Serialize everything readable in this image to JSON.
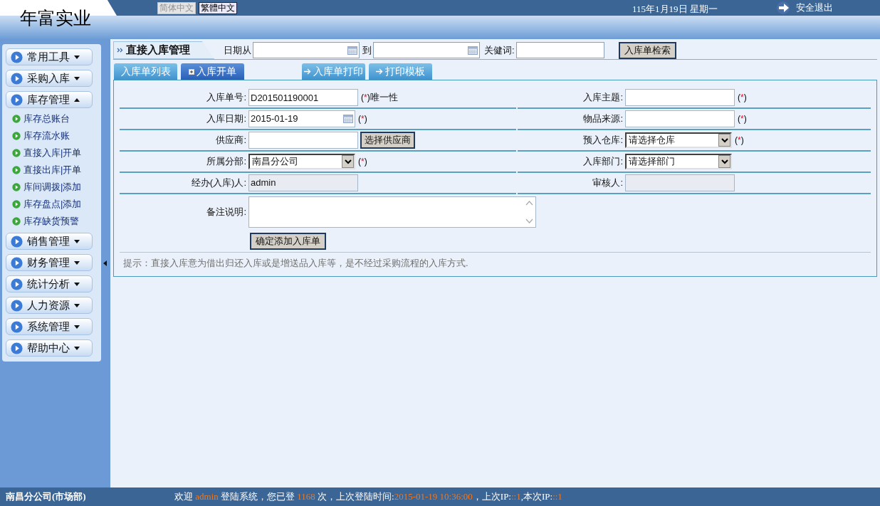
{
  "header": {
    "logo": "年富实业",
    "languages": [
      {
        "label": "简体中文",
        "selected": false
      },
      {
        "label": "繁體中文",
        "selected": true
      }
    ],
    "date": "115年1月19日 星期一",
    "logout": "安全退出"
  },
  "sidebar": {
    "groups": [
      {
        "label": "常用工具",
        "expanded": false
      },
      {
        "label": "采购入库",
        "expanded": false
      },
      {
        "label": "库存管理",
        "expanded": true,
        "children": [
          {
            "label": "库存总账台"
          },
          {
            "label": "库存流水账"
          },
          {
            "label": "直接入库|开单"
          },
          {
            "label": "直接出库|开单"
          },
          {
            "label": "库间调拨|添加"
          },
          {
            "label": "库存盘点|添加"
          },
          {
            "label": "库存缺货预警"
          }
        ]
      },
      {
        "label": "销售管理",
        "expanded": false
      },
      {
        "label": "财务管理",
        "expanded": false
      },
      {
        "label": "统计分析",
        "expanded": false
      },
      {
        "label": "人力资源",
        "expanded": false
      },
      {
        "label": "系统管理",
        "expanded": false
      },
      {
        "label": "帮助中心",
        "expanded": false
      }
    ]
  },
  "toolbar": {
    "title": "直接入库管理",
    "date_from_label": "日期从",
    "date_to_label": "到",
    "keyword_label": "关健词:",
    "search_button": "入库单检索"
  },
  "tabs": [
    {
      "label": "入库单列表",
      "selected": false,
      "kind": "plain"
    },
    {
      "label": "入库开单",
      "selected": true,
      "kind": "plus"
    },
    {
      "label": "入库单打印",
      "selected": false,
      "kind": "arrow"
    },
    {
      "label": "打印模板",
      "selected": false,
      "kind": "arrow"
    }
  ],
  "form": {
    "rows": [
      [
        {
          "label": "入库单号:",
          "kind": "text",
          "value": "D201501190001",
          "required": "(*)",
          "note": "唯一性"
        },
        {
          "label": "入库主题:",
          "kind": "text",
          "required": "(*)"
        }
      ],
      [
        {
          "label": "入库日期:",
          "kind": "date",
          "value": "2015-01-19",
          "required": "(*)"
        },
        {
          "label": "物品来源:",
          "kind": "text",
          "required": "(*)"
        }
      ],
      [
        {
          "label": "供应商:",
          "kind": "text",
          "button": "选择供应商"
        },
        {
          "label": "预入仓库:",
          "kind": "select",
          "value": "请选择仓库",
          "required": "(*)"
        }
      ],
      [
        {
          "label": "所属分部:",
          "kind": "select",
          "value": "南昌分公司",
          "required": "(*)"
        },
        {
          "label": "入库部门:",
          "kind": "select",
          "value": "请选择部门"
        }
      ],
      [
        {
          "label": "经办(入库)人:",
          "kind": "readonly",
          "value": "admin"
        },
        {
          "label": "审核人:",
          "kind": "readonly"
        }
      ]
    ],
    "remark_label": "备注说明:",
    "submit": "确定添加入库单",
    "hint": "提示：直接入库意为借出归还入库或是增送品入库等，是不经过采购流程的入库方式."
  },
  "footer": {
    "branch": "南昌分公司(市场部)",
    "welcome": [
      {
        "text": "欢迎 ",
        "highlight": false
      },
      {
        "text": "admin",
        "highlight": true
      },
      {
        "text": " 登陆系统，您已登 ",
        "highlight": false
      },
      {
        "text": "1168",
        "highlight": true
      },
      {
        "text": " 次，上次登陆时间:",
        "highlight": false
      },
      {
        "text": "2015-01-19 10:36:00",
        "highlight": true
      },
      {
        "text": "，上次IP:",
        "highlight": false
      },
      {
        "text": "::1",
        "highlight": true
      },
      {
        "text": ",本次IP:",
        "highlight": false
      },
      {
        "text": "::1",
        "highlight": true
      }
    ]
  }
}
